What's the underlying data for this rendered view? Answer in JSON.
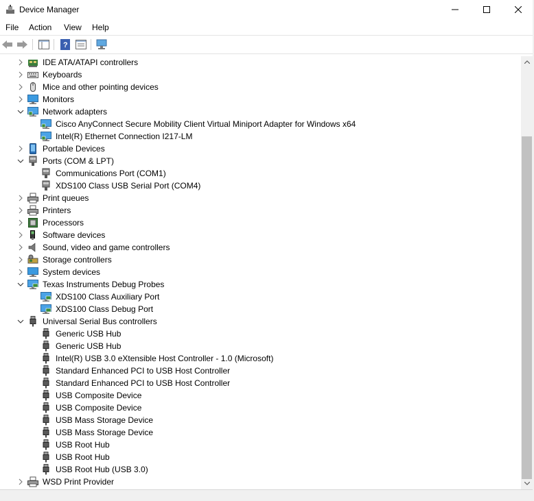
{
  "window": {
    "title": "Device Manager",
    "minimize": "—",
    "maximize": "☐",
    "close": "✕"
  },
  "menu": [
    "File",
    "Action",
    "View",
    "Help"
  ],
  "tree": [
    {
      "label": "IDE ATA/ATAPI controllers",
      "level": 0,
      "state": "collapsed",
      "icon": "ide-controller-icon"
    },
    {
      "label": "Keyboards",
      "level": 0,
      "state": "collapsed",
      "icon": "keyboard-icon"
    },
    {
      "label": "Mice and other pointing devices",
      "level": 0,
      "state": "collapsed",
      "icon": "mouse-icon"
    },
    {
      "label": "Monitors",
      "level": 0,
      "state": "collapsed",
      "icon": "monitor-icon"
    },
    {
      "label": "Network adapters",
      "level": 0,
      "state": "expanded",
      "icon": "network-adapter-icon"
    },
    {
      "label": "Cisco AnyConnect Secure Mobility Client Virtual Miniport Adapter for Windows x64",
      "level": 1,
      "icon": "network-adapter-icon"
    },
    {
      "label": "Intel(R) Ethernet Connection I217-LM",
      "level": 1,
      "icon": "network-adapter-icon"
    },
    {
      "label": "Portable Devices",
      "level": 0,
      "state": "collapsed",
      "icon": "portable-device-icon"
    },
    {
      "label": "Ports (COM & LPT)",
      "level": 0,
      "state": "expanded",
      "icon": "port-icon"
    },
    {
      "label": "Communications Port (COM1)",
      "level": 1,
      "icon": "port-icon"
    },
    {
      "label": "XDS100 Class USB Serial Port (COM4)",
      "level": 1,
      "icon": "port-icon"
    },
    {
      "label": "Print queues",
      "level": 0,
      "state": "collapsed",
      "icon": "printer-icon"
    },
    {
      "label": "Printers",
      "level": 0,
      "state": "collapsed",
      "icon": "printer-icon"
    },
    {
      "label": "Processors",
      "level": 0,
      "state": "collapsed",
      "icon": "processor-icon"
    },
    {
      "label": "Software devices",
      "level": 0,
      "state": "collapsed",
      "icon": "software-device-icon"
    },
    {
      "label": "Sound, video and game controllers",
      "level": 0,
      "state": "collapsed",
      "icon": "speaker-icon"
    },
    {
      "label": "Storage controllers",
      "level": 0,
      "state": "collapsed",
      "icon": "storage-controller-icon"
    },
    {
      "label": "System devices",
      "level": 0,
      "state": "collapsed",
      "icon": "system-device-icon"
    },
    {
      "label": "Texas Instruments Debug Probes",
      "level": 0,
      "state": "expanded",
      "icon": "debug-probe-icon"
    },
    {
      "label": "XDS100 Class Auxiliary Port",
      "level": 1,
      "icon": "debug-probe-icon"
    },
    {
      "label": "XDS100 Class Debug Port",
      "level": 1,
      "icon": "debug-probe-icon"
    },
    {
      "label": "Universal Serial Bus controllers",
      "level": 0,
      "state": "expanded",
      "icon": "usb-icon"
    },
    {
      "label": "Generic USB Hub",
      "level": 1,
      "icon": "usb-icon"
    },
    {
      "label": "Generic USB Hub",
      "level": 1,
      "icon": "usb-icon"
    },
    {
      "label": "Intel(R) USB 3.0 eXtensible Host Controller - 1.0 (Microsoft)",
      "level": 1,
      "icon": "usb-icon"
    },
    {
      "label": "Standard Enhanced PCI to USB Host Controller",
      "level": 1,
      "icon": "usb-icon"
    },
    {
      "label": "Standard Enhanced PCI to USB Host Controller",
      "level": 1,
      "icon": "usb-icon"
    },
    {
      "label": "USB Composite Device",
      "level": 1,
      "icon": "usb-icon"
    },
    {
      "label": "USB Composite Device",
      "level": 1,
      "icon": "usb-icon"
    },
    {
      "label": "USB Mass Storage Device",
      "level": 1,
      "icon": "usb-icon"
    },
    {
      "label": "USB Mass Storage Device",
      "level": 1,
      "icon": "usb-icon"
    },
    {
      "label": "USB Root Hub",
      "level": 1,
      "icon": "usb-icon"
    },
    {
      "label": "USB Root Hub",
      "level": 1,
      "icon": "usb-icon"
    },
    {
      "label": "USB Root Hub (USB 3.0)",
      "level": 1,
      "icon": "usb-icon"
    },
    {
      "label": "WSD Print Provider",
      "level": 0,
      "state": "collapsed",
      "icon": "printer-icon"
    }
  ]
}
